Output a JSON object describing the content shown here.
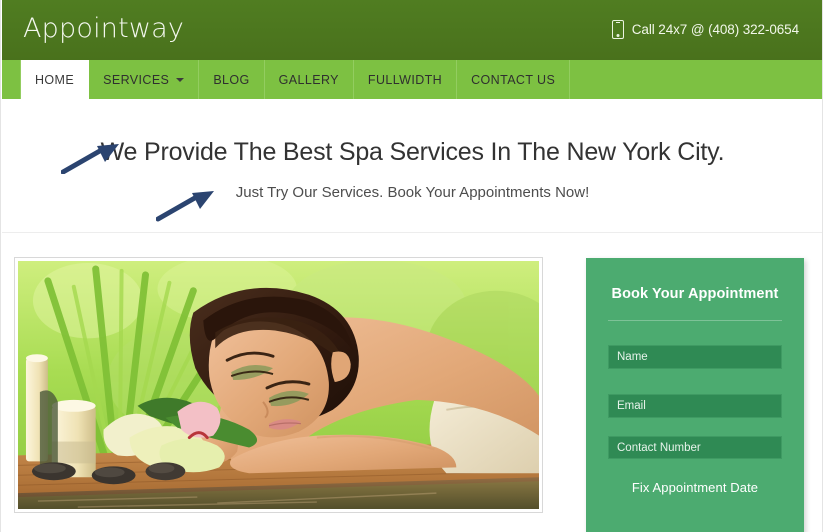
{
  "header": {
    "logo": "Appointway",
    "phone_icon": "mobile-phone-icon",
    "phone_text": "Call 24x7 @ (408) 322-0654",
    "bg_color": "#4d7a1f"
  },
  "nav": {
    "bg_color": "#7dc142",
    "items": [
      {
        "label": "HOME",
        "active": true,
        "has_dropdown": false
      },
      {
        "label": "SERVICES",
        "active": false,
        "has_dropdown": true
      },
      {
        "label": "BLOG",
        "active": false,
        "has_dropdown": false
      },
      {
        "label": "GALLERY",
        "active": false,
        "has_dropdown": false
      },
      {
        "label": "FULLWIDTH",
        "active": false,
        "has_dropdown": false
      },
      {
        "label": "CONTACT US",
        "active": false,
        "has_dropdown": false
      }
    ]
  },
  "hero": {
    "title": "We Provide The Best Spa Services In The New York City.",
    "subtitle": "Just Try Our Services. Book Your Appointments Now!"
  },
  "annotations": {
    "color": "#2b4470",
    "arrows": [
      {
        "name": "arrow-pointing-to-heading"
      },
      {
        "name": "arrow-pointing-to-subheading"
      }
    ]
  },
  "main": {
    "photo_alt": "spa-woman-massage-photo"
  },
  "booking_form": {
    "title": "Book Your Appointment",
    "accent_color": "#4cab70",
    "field_color": "#2f8a54",
    "fields": [
      {
        "name": "name",
        "placeholder": "Name"
      },
      {
        "name": "email",
        "placeholder": "Email"
      },
      {
        "name": "contact",
        "placeholder": "Contact Number"
      }
    ],
    "date_label": "Fix Appointment Date"
  }
}
